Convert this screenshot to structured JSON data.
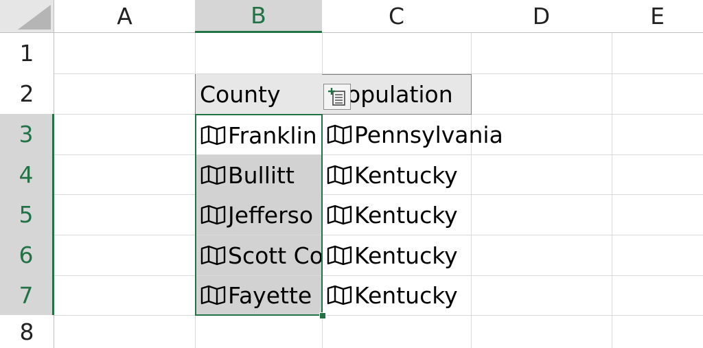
{
  "columns": [
    "A",
    "B",
    "C",
    "D",
    "E"
  ],
  "rows": [
    "1",
    "2",
    "3",
    "4",
    "5",
    "6",
    "7",
    "8"
  ],
  "active_column": "B",
  "active_rows": [
    "3",
    "4",
    "5",
    "6",
    "7"
  ],
  "cells": {
    "B2": "County",
    "C2": "opulation",
    "B3": "Franklin",
    "B4": "Bullitt",
    "B5": "Jefferso",
    "B6": "Scott Co",
    "B7": "Fayette",
    "C3": "Pennsylvania",
    "C4": "Kentucky",
    "C5": "Kentucky",
    "C6": "Kentucky",
    "C7": "Kentucky"
  },
  "data_type_icon": "map-icon",
  "insert_data_icon": "insert-data-icon",
  "colors": {
    "accent": "#217346",
    "header_bg": "#d6d6d6",
    "selection_fill": "#d2d2d2",
    "table_header_bg": "#e7e7e7"
  }
}
